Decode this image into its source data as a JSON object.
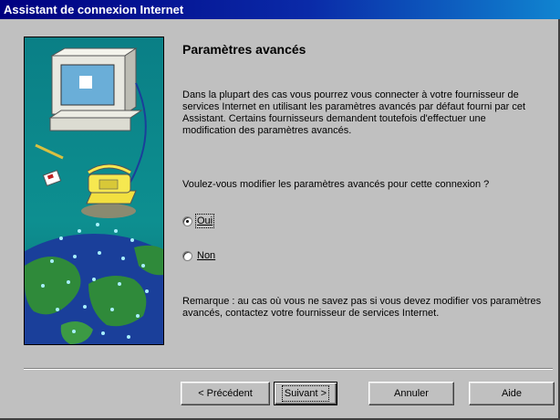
{
  "window": {
    "title": "Assistant de connexion Internet"
  },
  "content": {
    "heading": "Paramètres avancés",
    "paragraph": "Dans la plupart des cas vous pourrez vous connecter à votre fournisseur de services Internet en utilisant les paramètres avancés par défaut fourni par cet Assistant. Certains fournisseurs demandent toutefois d'effectuer une modification des paramètres avancés.",
    "question": "Voulez-vous modifier les paramètres avancés pour cette connexion ?",
    "options": [
      {
        "label": "Oui",
        "checked": true
      },
      {
        "label": "Non",
        "checked": false
      }
    ],
    "note": "Remarque : au cas où vous ne savez pas si vous devez modifier vos paramètres avancés, contactez votre fournisseur de services Internet."
  },
  "buttons": {
    "back": "< Précédent",
    "next": "Suivant >",
    "cancel": "Annuler",
    "help": "Aide"
  },
  "icons": {
    "illustration": "computer-phone-globe-illustration"
  },
  "colors": {
    "titlebar_start": "#000080",
    "titlebar_end": "#1084d0",
    "panel_bg": "#008b8b",
    "dialog_bg": "#c0c0c0"
  }
}
